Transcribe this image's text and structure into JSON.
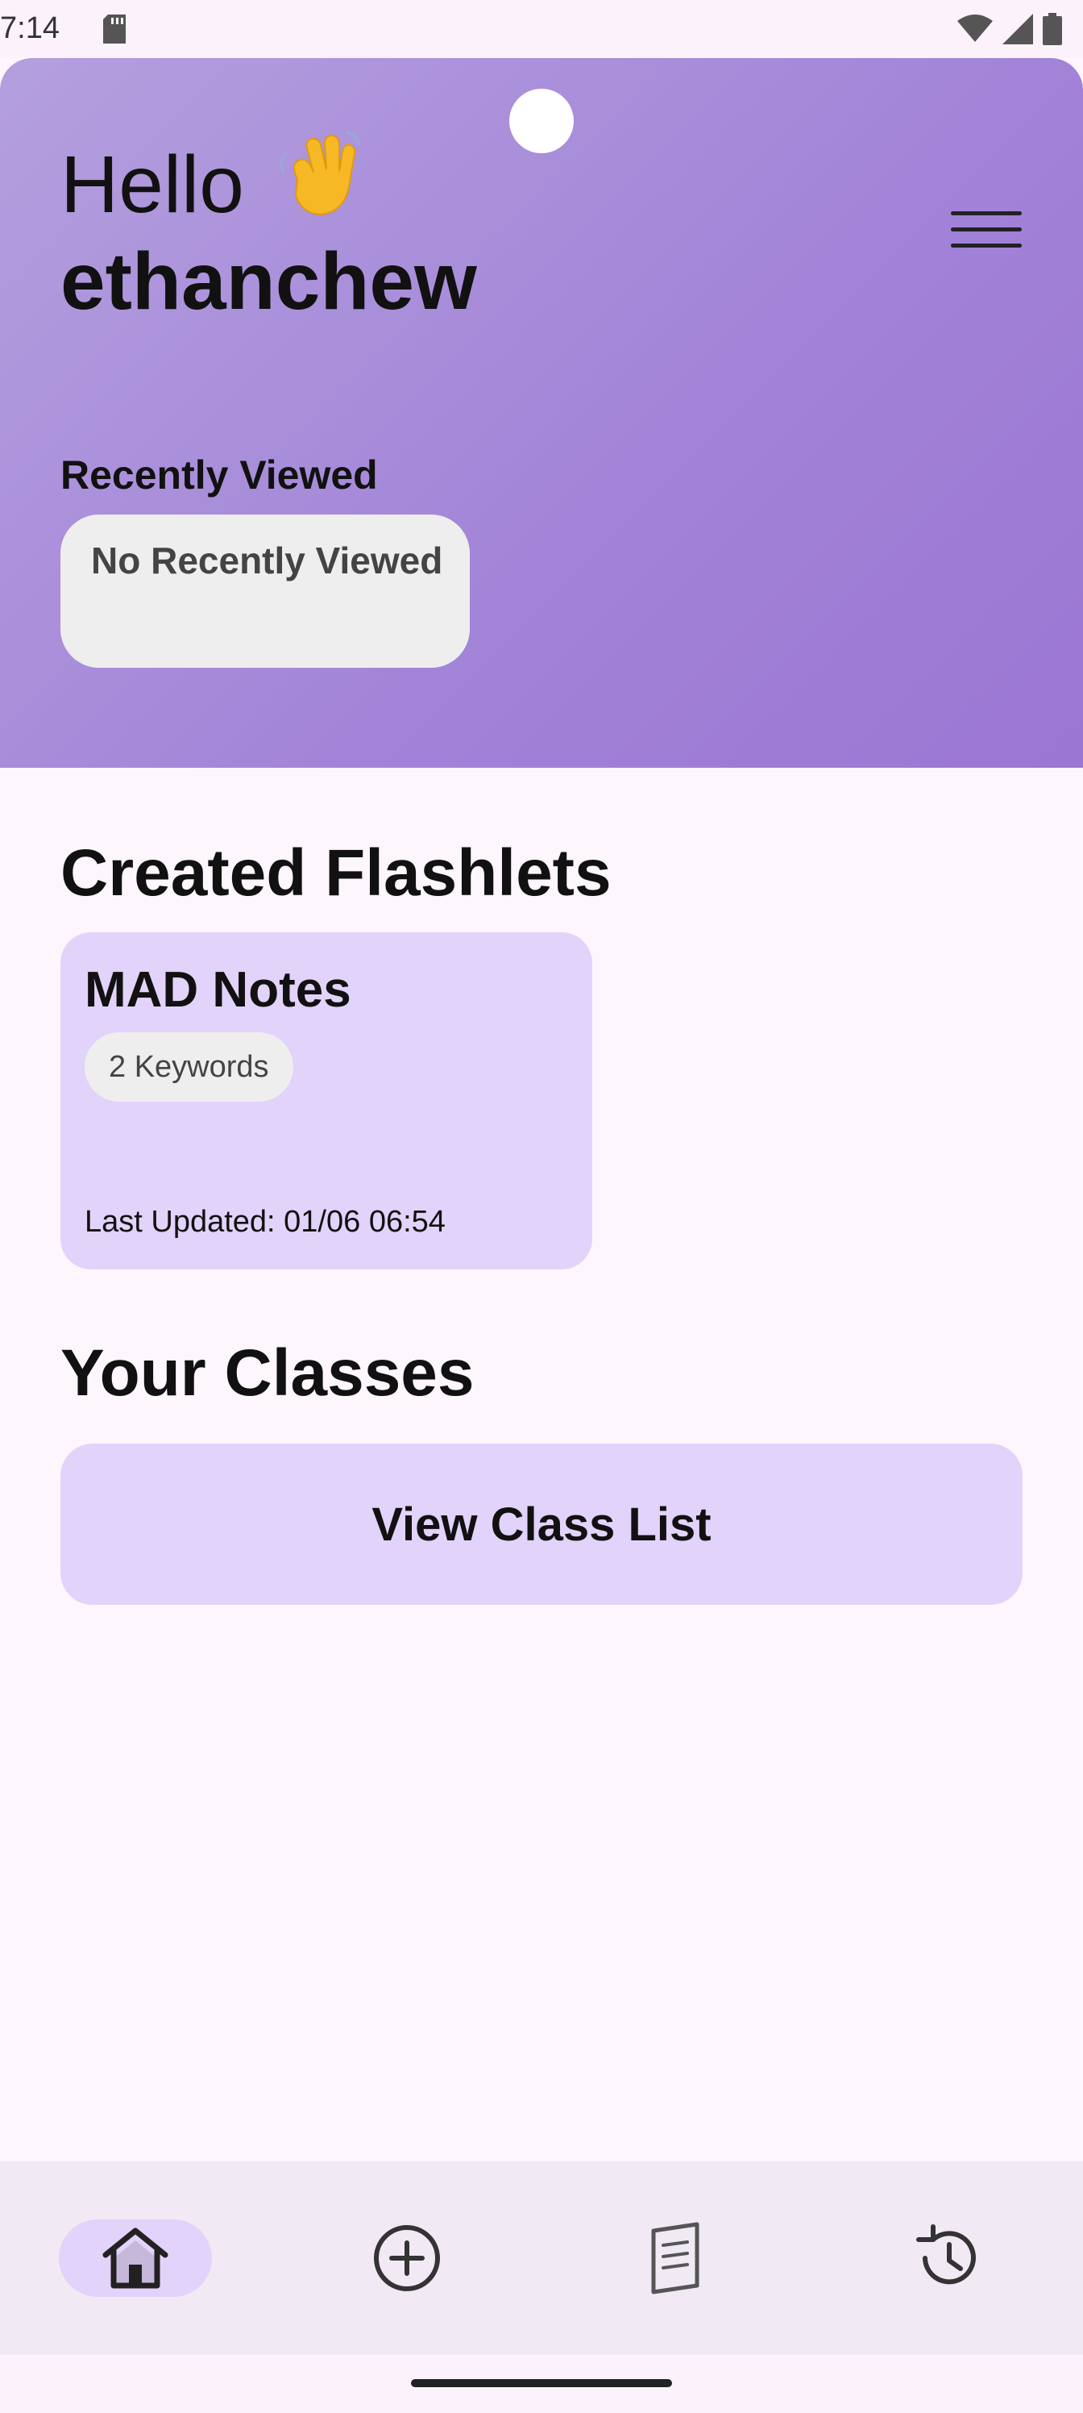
{
  "status_bar": {
    "time": "7:14",
    "icons": [
      "sd-card-icon",
      "wifi-icon",
      "signal-icon",
      "battery-icon"
    ]
  },
  "header": {
    "greeting": "Hello",
    "wave_emoji": "wave-icon",
    "username": "ethanchew",
    "menu_icon": "hamburger-menu-icon",
    "recently_viewed_label": "Recently Viewed",
    "recently_viewed_empty": "No Recently Viewed",
    "gradient_colors": [
      "#b49fde",
      "#9b76d3"
    ]
  },
  "created_flashlets": {
    "title": "Created Flashlets",
    "items": [
      {
        "title": "MAD Notes",
        "keywords": "2 Keywords",
        "last_updated": "Last Updated: 01/06 06:54"
      }
    ]
  },
  "classes": {
    "title": "Your Classes",
    "button_label": "View Class List"
  },
  "bottom_nav": {
    "items": [
      {
        "icon": "home-icon",
        "active": true
      },
      {
        "icon": "add-circle-icon",
        "active": false
      },
      {
        "icon": "document-icon",
        "active": false
      },
      {
        "icon": "history-icon",
        "active": false
      }
    ]
  },
  "colors": {
    "accent": "#e2d3fb",
    "background": "#fdf6fd",
    "chip": "#efeeee"
  }
}
